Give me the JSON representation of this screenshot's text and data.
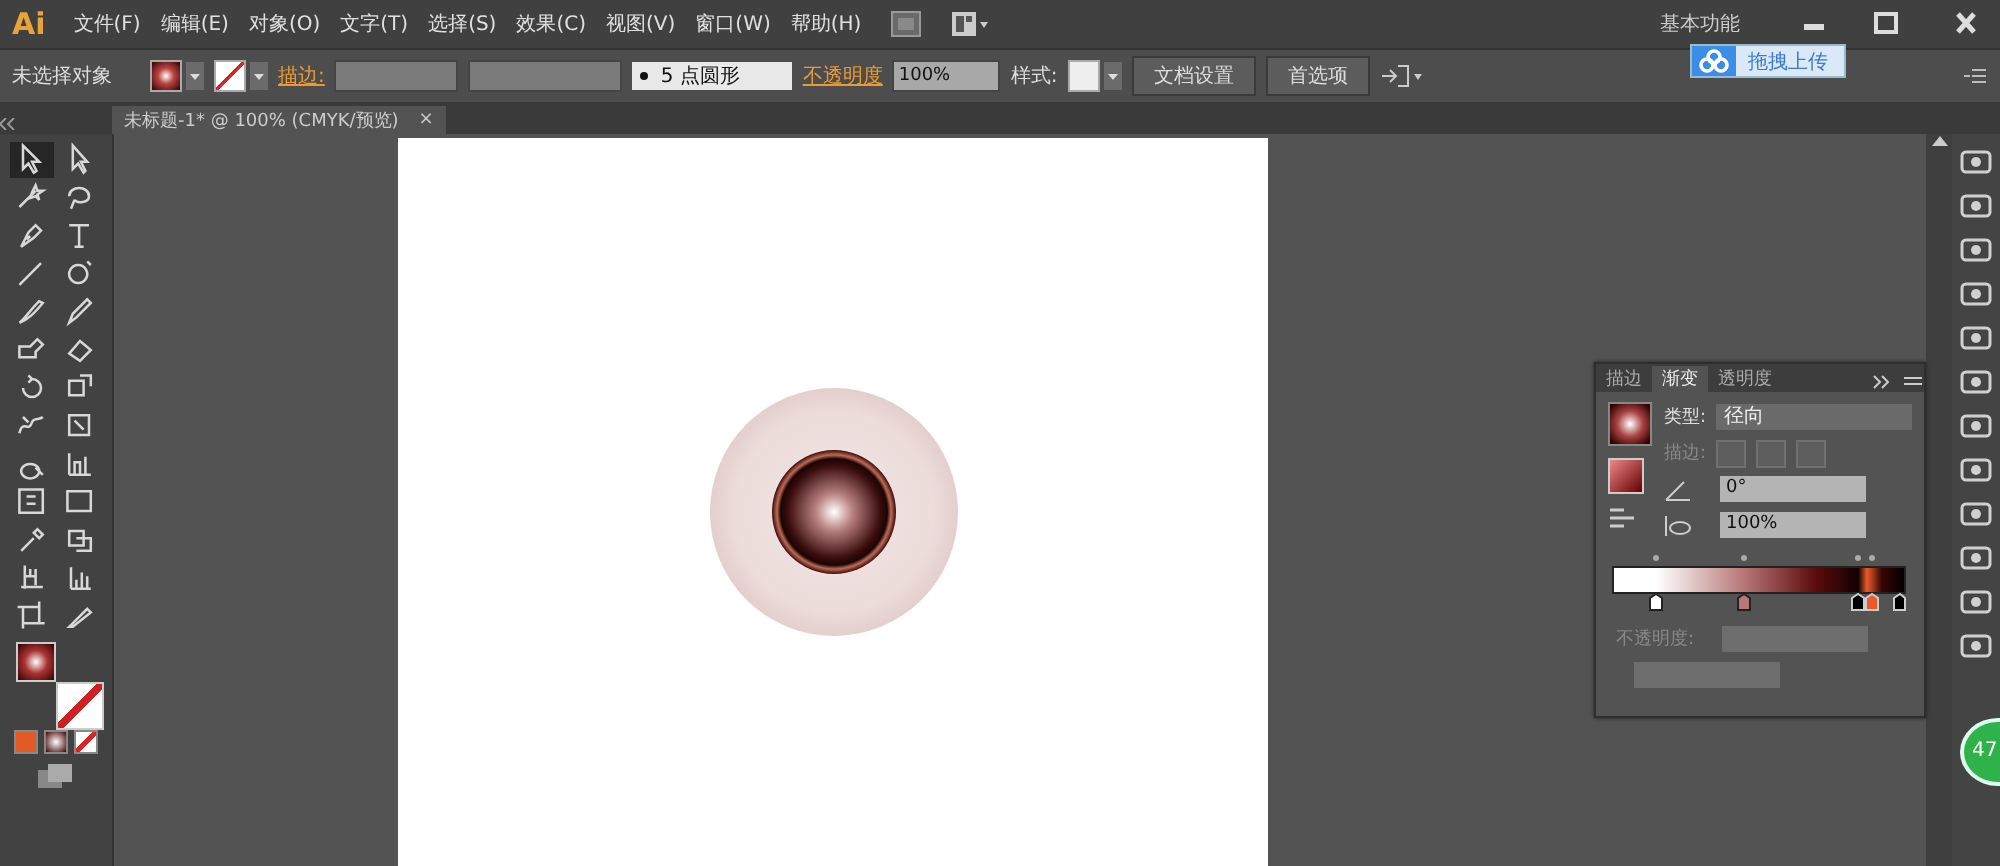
{
  "app": {
    "logo": "Ai",
    "workspace": "基本功能"
  },
  "menu": [
    "文件(F)",
    "编辑(E)",
    "对象(O)",
    "文字(T)",
    "选择(S)",
    "效果(C)",
    "视图(V)",
    "窗口(W)",
    "帮助(H)"
  ],
  "upload_tip": {
    "label": "拖拽上传"
  },
  "control_bar": {
    "selection": "未选择对象",
    "stroke_label": "描边:",
    "brush": "5 点圆形",
    "opacity_label": "不透明度",
    "opacity": "100%",
    "style_label": "样式:",
    "buttons": [
      "文档设置",
      "首选项"
    ]
  },
  "document_tab": {
    "title": "未标题-1* @ 100% (CMYK/预览)",
    "close": "×"
  },
  "tools": [
    {
      "selected": true
    },
    {
      "selected": false
    },
    {
      "selected": false
    },
    {
      "selected": false
    },
    {
      "selected": false
    },
    {
      "selected": false
    },
    {
      "selected": false
    },
    {
      "selected": false
    },
    {
      "selected": false
    },
    {
      "selected": false
    },
    {
      "selected": false
    },
    {
      "selected": false
    },
    {
      "selected": false
    },
    {
      "selected": false
    },
    {
      "selected": false
    },
    {
      "selected": false
    },
    {
      "selected": false
    },
    {
      "selected": false
    },
    {
      "selected": false
    },
    {
      "selected": false
    },
    {
      "selected": false
    },
    {
      "selected": false
    },
    {
      "selected": false
    },
    {
      "selected": false
    },
    {
      "selected": false
    },
    {
      "selected": false
    }
  ],
  "gradient_panel": {
    "tabs": [
      {
        "label": "描边",
        "selected": false
      },
      {
        "label": "渐变",
        "selected": true
      },
      {
        "label": "透明度",
        "selected": false
      }
    ],
    "type_label": "类型:",
    "type": "径向",
    "stroke_label": "描边:",
    "angle": "0°",
    "aspect": "100%",
    "opacity_label": "不透明度:"
  },
  "badge": "47"
}
